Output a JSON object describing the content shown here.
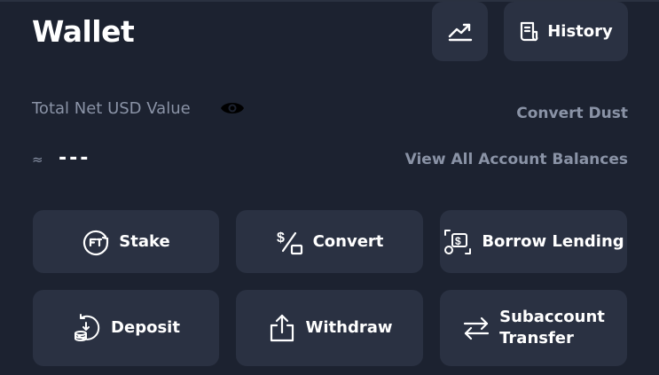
{
  "header": {
    "title": "Wallet",
    "chart_icon": "trending-up-icon",
    "history": {
      "label": "History",
      "icon": "receipt-icon"
    }
  },
  "balance": {
    "label": "Total Net USD Value",
    "visibility_icon": "eye-icon",
    "approx_symbol": "≈",
    "value": "---",
    "convert_dust_label": "Convert Dust",
    "view_all_label": "View All Account Balances"
  },
  "actions": [
    {
      "label": "Stake",
      "icon": "stake-icon"
    },
    {
      "label": "Convert",
      "icon": "convert-icon"
    },
    {
      "label": "Borrow Lending",
      "icon": "borrow-lending-icon"
    },
    {
      "label": "Deposit",
      "icon": "deposit-icon"
    },
    {
      "label": "Withdraw",
      "icon": "withdraw-icon"
    },
    {
      "label_line1": "Subaccount",
      "label_line2": "Transfer",
      "icon": "transfer-icon"
    }
  ],
  "colors": {
    "background": "#1c2230",
    "card": "#2a3142",
    "muted_text": "#8a93a6",
    "text": "#ffffff"
  }
}
